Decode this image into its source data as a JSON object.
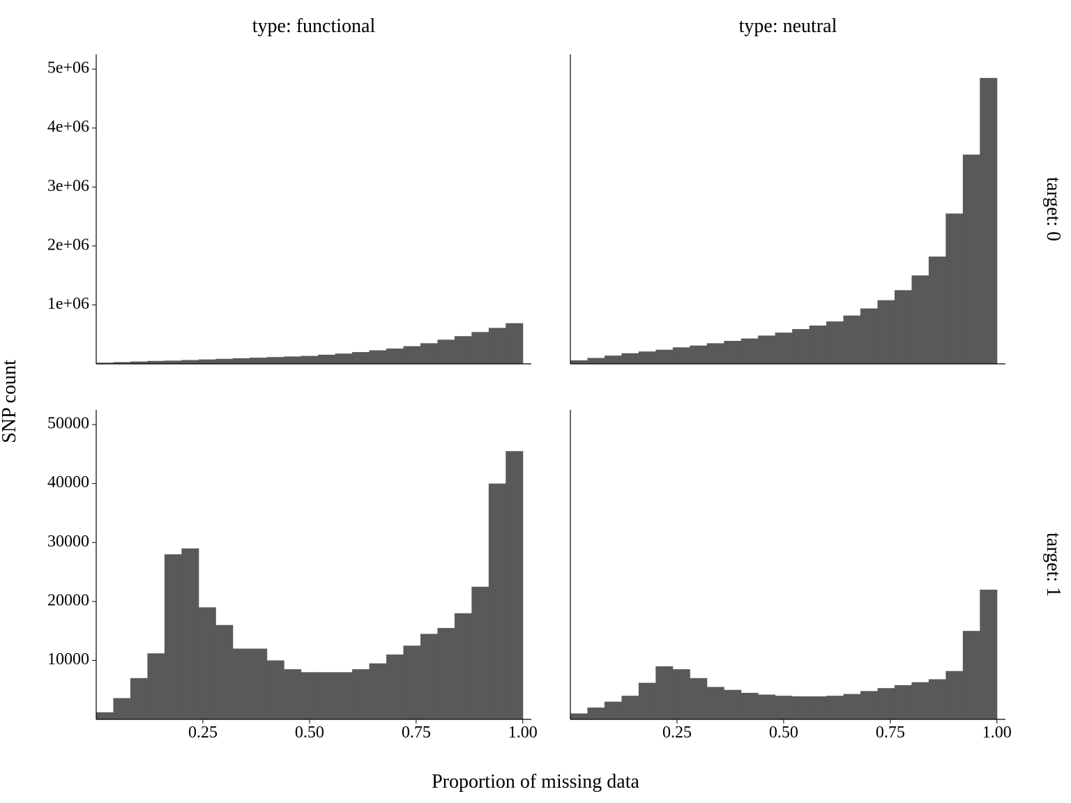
{
  "chart_data": [
    {
      "type": "bar",
      "panel_id": "functional-target0",
      "col_label": "type: functional",
      "row_label": "target: 0",
      "x_breaks": [
        0.04,
        0.08,
        0.12,
        0.16,
        0.2,
        0.24,
        0.28,
        0.32,
        0.36,
        0.4,
        0.44,
        0.48,
        0.52,
        0.56,
        0.6,
        0.64,
        0.68,
        0.72,
        0.76,
        0.8,
        0.84,
        0.88,
        0.92,
        0.96,
        1.0
      ],
      "values": [
        20000,
        30000,
        40000,
        50000,
        55000,
        65000,
        75000,
        85000,
        95000,
        105000,
        115000,
        125000,
        135000,
        155000,
        175000,
        200000,
        230000,
        260000,
        300000,
        350000,
        410000,
        470000,
        540000,
        610000,
        690000
      ],
      "x_ticks": [
        0.25,
        0.5,
        0.75,
        1.0
      ],
      "x_tick_labels": [
        "0.25",
        "0.50",
        "0.75",
        "1.00"
      ],
      "y_ticks": [
        1000000,
        2000000,
        3000000,
        4000000,
        5000000
      ],
      "y_tick_labels": [
        "1e+06",
        "2e+06",
        "3e+06",
        "4e+06",
        "5e+06"
      ],
      "xlim": [
        0.0,
        1.02
      ],
      "ylim": [
        0,
        5250000
      ],
      "show_y_ticks": true,
      "show_x_ticks": false
    },
    {
      "type": "bar",
      "panel_id": "neutral-target0",
      "col_label": "type: neutral",
      "row_label": "target: 0",
      "x_breaks": [
        0.04,
        0.08,
        0.12,
        0.16,
        0.2,
        0.24,
        0.28,
        0.32,
        0.36,
        0.4,
        0.44,
        0.48,
        0.52,
        0.56,
        0.6,
        0.64,
        0.68,
        0.72,
        0.76,
        0.8,
        0.84,
        0.88,
        0.92,
        0.96,
        1.0
      ],
      "values": [
        60000,
        100000,
        140000,
        180000,
        210000,
        240000,
        280000,
        310000,
        350000,
        390000,
        430000,
        480000,
        530000,
        590000,
        650000,
        720000,
        820000,
        940000,
        1080000,
        1250000,
        1500000,
        1820000,
        2550000,
        3550000,
        4850000
      ],
      "x_ticks": [
        0.25,
        0.5,
        0.75,
        1.0
      ],
      "x_tick_labels": [
        "0.25",
        "0.50",
        "0.75",
        "1.00"
      ],
      "y_ticks": [
        1000000,
        2000000,
        3000000,
        4000000,
        5000000
      ],
      "y_tick_labels": [
        "1e+06",
        "2e+06",
        "3e+06",
        "4e+06",
        "5e+06"
      ],
      "xlim": [
        0.0,
        1.02
      ],
      "ylim": [
        0,
        5250000
      ],
      "show_y_ticks": false,
      "show_x_ticks": false
    },
    {
      "type": "bar",
      "panel_id": "functional-target1",
      "col_label": "type: functional",
      "row_label": "target: 1",
      "x_breaks": [
        0.04,
        0.08,
        0.12,
        0.16,
        0.2,
        0.24,
        0.28,
        0.32,
        0.36,
        0.4,
        0.44,
        0.48,
        0.52,
        0.56,
        0.6,
        0.64,
        0.68,
        0.72,
        0.76,
        0.8,
        0.84,
        0.88,
        0.92,
        0.96,
        1.0
      ],
      "values": [
        1200,
        3600,
        7000,
        11200,
        28000,
        29000,
        19000,
        16000,
        12000,
        12000,
        10000,
        8500,
        8000,
        8000,
        8000,
        8500,
        9500,
        11000,
        12500,
        14500,
        15500,
        18000,
        22500,
        40000,
        45500
      ],
      "x_ticks": [
        0.25,
        0.5,
        0.75,
        1.0
      ],
      "x_tick_labels": [
        "0.25",
        "0.50",
        "0.75",
        "1.00"
      ],
      "y_ticks": [
        10000,
        20000,
        30000,
        40000,
        50000
      ],
      "y_tick_labels": [
        "10000",
        "20000",
        "30000",
        "40000",
        "50000"
      ],
      "xlim": [
        0.0,
        1.02
      ],
      "ylim": [
        0,
        52500
      ],
      "show_y_ticks": true,
      "show_x_ticks": true
    },
    {
      "type": "bar",
      "panel_id": "neutral-target1",
      "col_label": "type: neutral",
      "row_label": "target: 1",
      "x_breaks": [
        0.04,
        0.08,
        0.12,
        0.16,
        0.2,
        0.24,
        0.28,
        0.32,
        0.36,
        0.4,
        0.44,
        0.48,
        0.52,
        0.56,
        0.6,
        0.64,
        0.68,
        0.72,
        0.76,
        0.8,
        0.84,
        0.88,
        0.92,
        0.96,
        1.0
      ],
      "values": [
        1000,
        2000,
        3000,
        4000,
        6200,
        9000,
        8500,
        7000,
        5500,
        5000,
        4500,
        4200,
        4000,
        3900,
        3900,
        4000,
        4300,
        4800,
        5300,
        5800,
        6300,
        6800,
        8200,
        15000,
        22000
      ],
      "x_ticks": [
        0.25,
        0.5,
        0.75,
        1.0
      ],
      "x_tick_labels": [
        "0.25",
        "0.50",
        "0.75",
        "1.00"
      ],
      "y_ticks": [
        10000,
        20000,
        30000,
        40000,
        50000
      ],
      "y_tick_labels": [
        "10000",
        "20000",
        "30000",
        "40000",
        "50000"
      ],
      "xlim": [
        0.0,
        1.02
      ],
      "ylim": [
        0,
        52500
      ],
      "show_y_ticks": false,
      "show_x_ticks": true
    }
  ],
  "layout": {
    "col_labels": [
      "type: functional",
      "type: neutral"
    ],
    "row_labels": [
      "target: 0",
      "target: 1"
    ],
    "xlabel": "Proportion of missing data",
    "ylabel": "SNP count"
  }
}
